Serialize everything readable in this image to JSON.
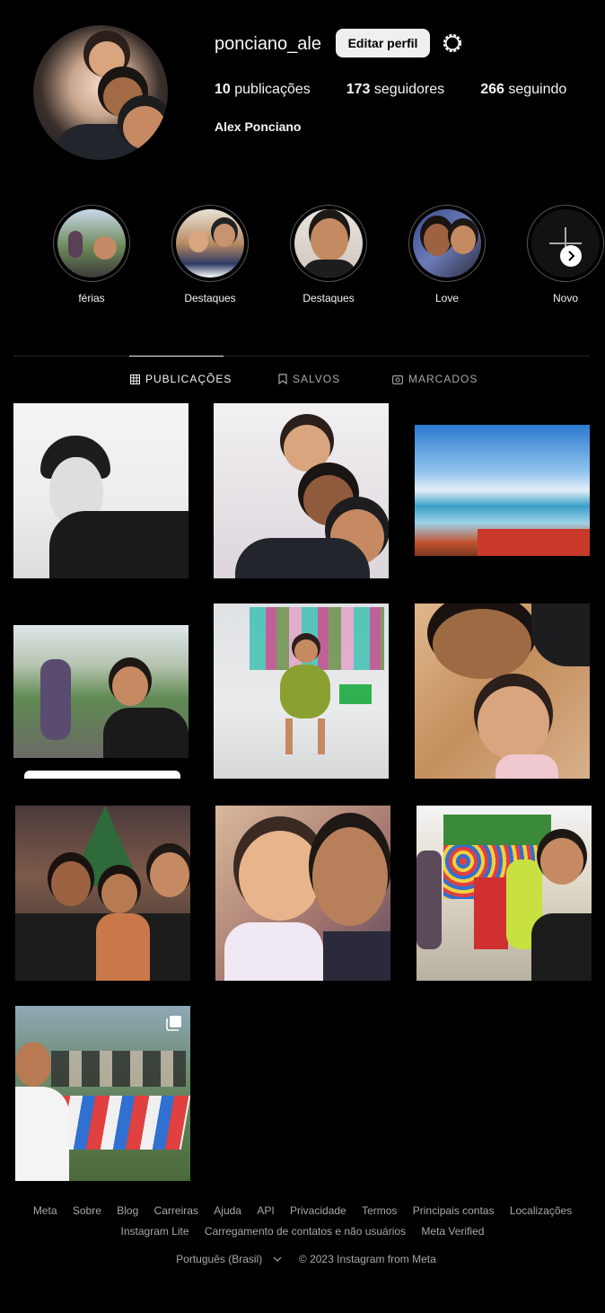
{
  "profile": {
    "username": "ponciano_ale",
    "edit_label": "Editar perfil",
    "posts_count": "10",
    "posts_label": "publicações",
    "followers_count": "173",
    "followers_label": "seguidores",
    "following_count": "266",
    "following_label": "seguindo",
    "full_name": "Alex Ponciano"
  },
  "highlights": [
    {
      "label": "férias"
    },
    {
      "label": "Destaques"
    },
    {
      "label": "Destaques"
    },
    {
      "label": "Love"
    },
    {
      "label": "Novo"
    }
  ],
  "tabs": [
    {
      "label": "PUBLICAÇÕES",
      "icon": "grid-icon",
      "active": true
    },
    {
      "label": "SALVOS",
      "icon": "bookmark-icon",
      "active": false
    },
    {
      "label": "MARCADOS",
      "icon": "tagged-icon",
      "active": false
    }
  ],
  "footer": {
    "links": [
      "Meta",
      "Sobre",
      "Blog",
      "Carreiras",
      "Ajuda",
      "API",
      "Privacidade",
      "Termos",
      "Principais contas",
      "Localizações",
      "Instagram Lite",
      "Carregamento de contatos e não usuários",
      "Meta Verified"
    ],
    "language": "Português (Brasil)",
    "copyright": "© 2023 Instagram from Meta"
  },
  "colors": {
    "background": "#000000",
    "button_bg": "#efefef",
    "muted_text": "#a8a8a8",
    "divider": "#262626"
  }
}
